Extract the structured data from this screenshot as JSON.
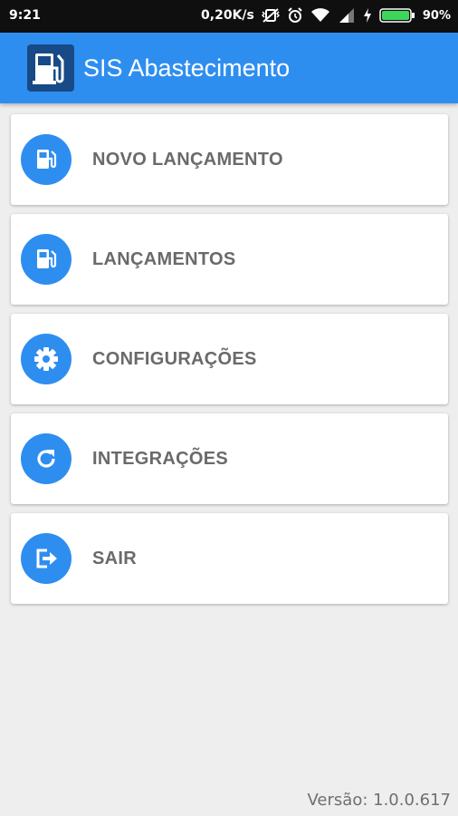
{
  "status_bar": {
    "time": "9:21",
    "network_speed": "0,20K/s",
    "battery_percent": "90%",
    "icons": [
      "vibrate-off-icon",
      "alarm-icon",
      "wifi-icon",
      "signal-icon",
      "charging-icon",
      "battery-icon"
    ]
  },
  "app_bar": {
    "title": "SIS Abastecimento",
    "logo_icon": "fuel-pump-icon",
    "color": "#2e8ef0"
  },
  "menu": {
    "items": [
      {
        "label": "NOVO LANÇAMENTO",
        "icon": "fuel-pump-icon"
      },
      {
        "label": "LANÇAMENTOS",
        "icon": "fuel-pump-icon"
      },
      {
        "label": "CONFIGURAÇÕES",
        "icon": "gear-icon"
      },
      {
        "label": "INTEGRAÇÕES",
        "icon": "refresh-icon"
      },
      {
        "label": "SAIR",
        "icon": "exit-icon"
      }
    ]
  },
  "footer": {
    "version": "Versão: 1.0.0.617"
  }
}
